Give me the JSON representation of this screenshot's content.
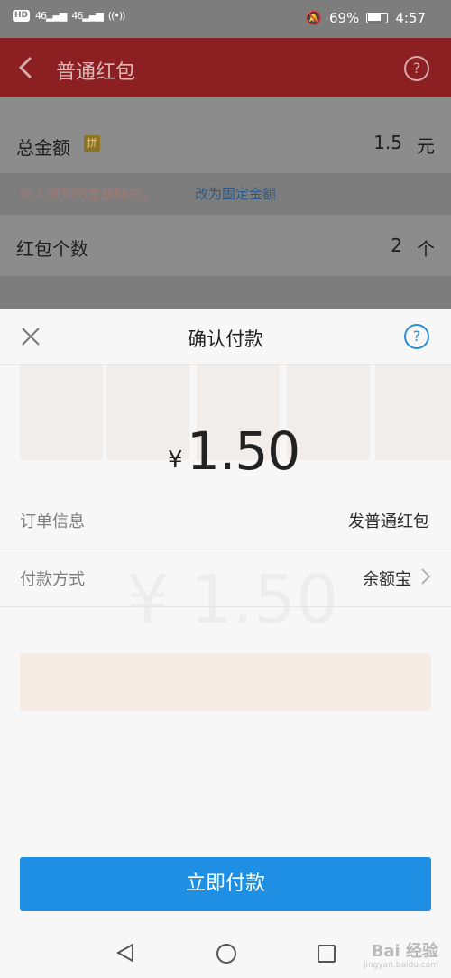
{
  "status_bar": {
    "hd": "HD",
    "sig1": "46",
    "sig2": "46",
    "battery": "69%",
    "time": "4:57"
  },
  "header": {
    "title": "普通红包",
    "help": "?"
  },
  "form": {
    "total_label": "总金额",
    "pin_badge": "拼",
    "total_value": "1.5",
    "total_unit": "元",
    "hint_text": "每人领到的金额随机，",
    "hint_link": "改为固定金额",
    "count_label": "红包个数",
    "count_value": "2",
    "count_unit": "个"
  },
  "sheet": {
    "title": "确认付款",
    "help": "?",
    "currency": "¥",
    "amount": "1.50",
    "order_label": "订单信息",
    "order_value": "发普通红包",
    "method_label": "付款方式",
    "method_value": "余额宝",
    "pay_button": "立即付款"
  },
  "watermark": {
    "brand": "Bai 经验",
    "url": "jingyan.baidu.com"
  },
  "colors": {
    "header": "#8b1f22",
    "accent": "#1f8fe4"
  }
}
